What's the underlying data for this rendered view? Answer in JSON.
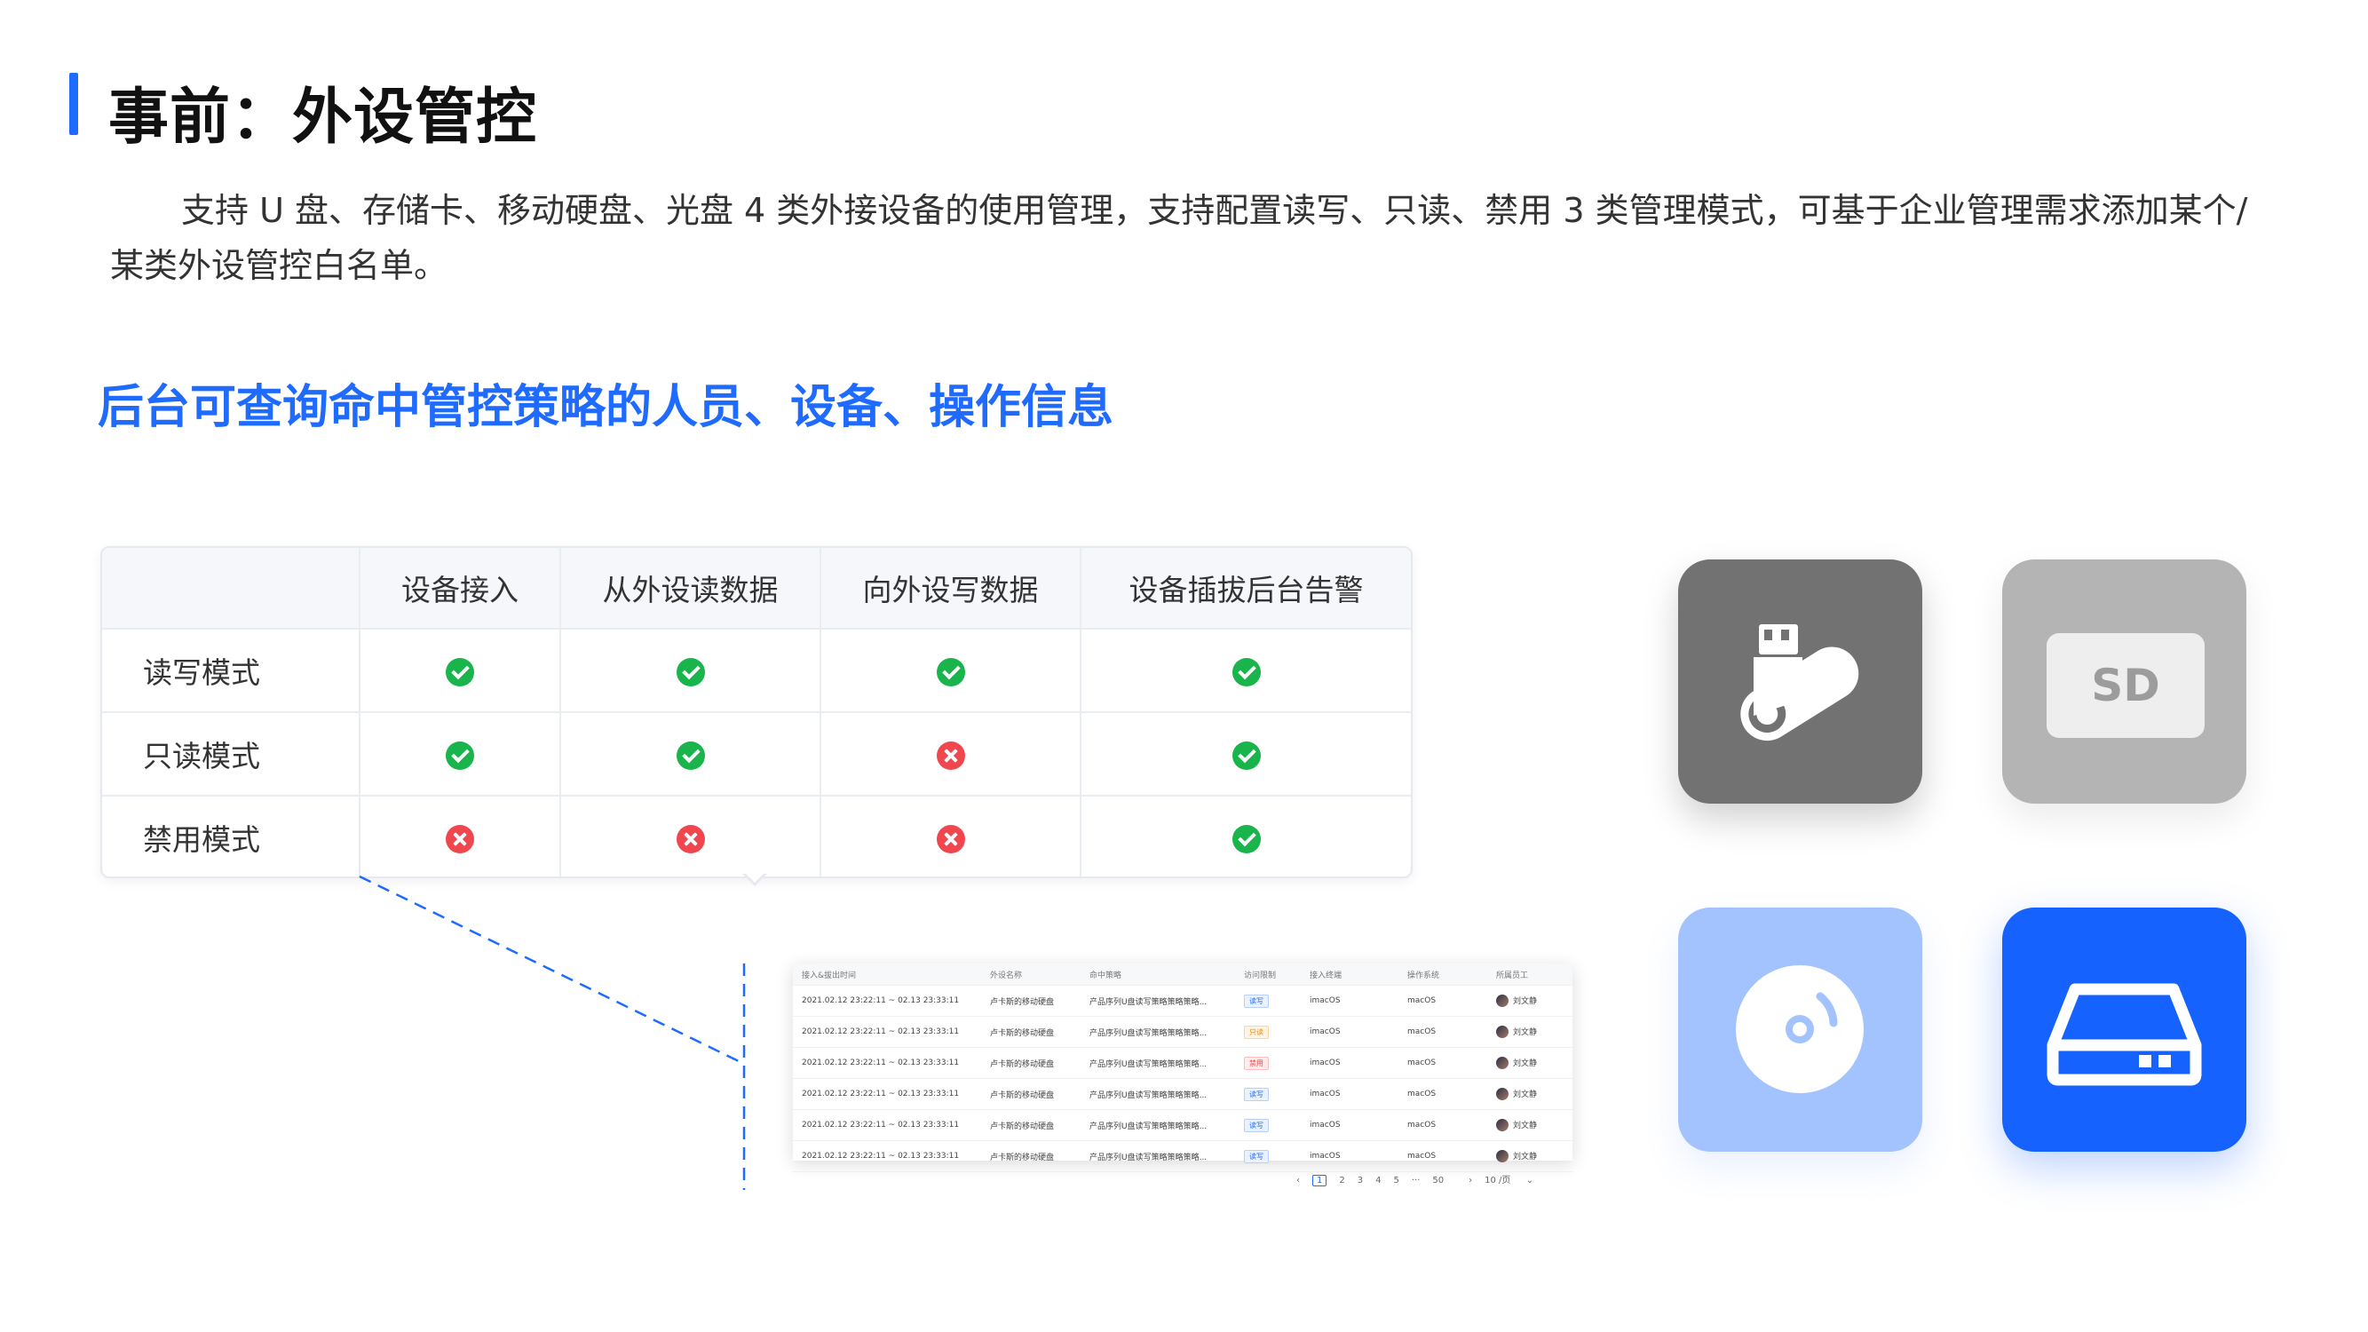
{
  "title": "事前：外设管控",
  "description": "支持 U 盘、存储卡、移动硬盘、光盘 4 类外接设备的使用管理，支持配置读写、只读、禁用 3 类管理模式，可基于企业管理需求添加某个/某类外设管控白名单。",
  "subtitle": "后台可查询命中管控策略的人员、设备、操作信息",
  "matrix": {
    "headers": [
      "",
      "设备接入",
      "从外设读数据",
      "向外设写数据",
      "设备插拔后台告警"
    ],
    "rows": [
      {
        "label": "读写模式",
        "cells": [
          "allowed",
          "allowed",
          "allowed",
          "allowed"
        ]
      },
      {
        "label": "只读模式",
        "cells": [
          "allowed",
          "allowed",
          "denied",
          "allowed"
        ]
      },
      {
        "label": "禁用模式",
        "cells": [
          "denied",
          "denied",
          "denied",
          "allowed"
        ]
      }
    ]
  },
  "log_table": {
    "headers": [
      "接入&拔出时间",
      "外设名称",
      "命中策略",
      "访问限制",
      "接入终端",
      "操作系统",
      "所属员工"
    ],
    "rows": [
      {
        "time": "2021.02.12 23:22:11 ~ 02.13 23:33:11",
        "device": "卢卡斯的移动硬盘",
        "policy": "产品序列U盘读写策略策略策略...",
        "access": "读写",
        "access_type": "rw",
        "terminal": "imacOS",
        "os": "macOS",
        "employee": "刘文静"
      },
      {
        "time": "2021.02.12 23:22:11 ~ 02.13 23:33:11",
        "device": "卢卡斯的移动硬盘",
        "policy": "产品序列U盘读写策略策略策略...",
        "access": "只读",
        "access_type": "ro",
        "terminal": "imacOS",
        "os": "macOS",
        "employee": "刘文静"
      },
      {
        "time": "2021.02.12 23:22:11 ~ 02.13 23:33:11",
        "device": "卢卡斯的移动硬盘",
        "policy": "产品序列U盘读写策略策略策略...",
        "access": "禁用",
        "access_type": "ban",
        "terminal": "imacOS",
        "os": "macOS",
        "employee": "刘文静"
      },
      {
        "time": "2021.02.12 23:22:11 ~ 02.13 23:33:11",
        "device": "卢卡斯的移动硬盘",
        "policy": "产品序列U盘读写策略策略策略...",
        "access": "读写",
        "access_type": "rw",
        "terminal": "imacOS",
        "os": "macOS",
        "employee": "刘文静"
      },
      {
        "time": "2021.02.12 23:22:11 ~ 02.13 23:33:11",
        "device": "卢卡斯的移动硬盘",
        "policy": "产品序列U盘读写策略策略策略...",
        "access": "读写",
        "access_type": "rw",
        "terminal": "imacOS",
        "os": "macOS",
        "employee": "刘文静"
      },
      {
        "time": "2021.02.12 23:22:11 ~ 02.13 23:33:11",
        "device": "卢卡斯的移动硬盘",
        "policy": "产品序列U盘读写策略策略策略...",
        "access": "读写",
        "access_type": "rw",
        "terminal": "imacOS",
        "os": "macOS",
        "employee": "刘文静"
      }
    ],
    "pagination": {
      "prev": "‹",
      "pages": [
        "1",
        "2",
        "3",
        "4",
        "5",
        "···",
        "50"
      ],
      "current": "1",
      "next": "›",
      "page_size": "10 /页",
      "dropdown": "⌄"
    }
  },
  "device_tiles": [
    {
      "icon": "usb-drive-icon",
      "label": ""
    },
    {
      "icon": "sd-card-icon",
      "label": "SD"
    },
    {
      "icon": "optical-disc-icon",
      "label": ""
    },
    {
      "icon": "hard-drive-icon",
      "label": ""
    }
  ],
  "colors": {
    "accent": "#1f6bff",
    "allowed": "#19b44b",
    "denied": "#f0464e",
    "tile_usb": "#727272",
    "tile_sd": "#b4b4b4",
    "tile_cd": "#a3c3ff",
    "tile_hdd": "#1662ff"
  }
}
